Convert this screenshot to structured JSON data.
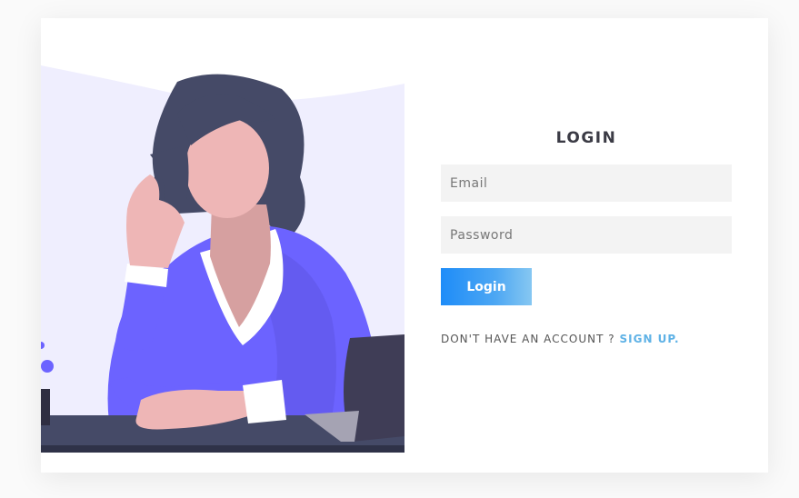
{
  "form": {
    "title": "LOGIN",
    "email_placeholder": "Email",
    "password_placeholder": "Password",
    "login_label": "Login",
    "signup_prompt": "DON'T HAVE AN ACCOUNT ?",
    "signup_link": "SIGN UP."
  },
  "colors": {
    "accent": "#1e8cf8",
    "link": "#5fb2e6",
    "field_bg": "#f3f3f3",
    "illustration_bg": "#efeefe",
    "shirt": "#6c63ff",
    "hair": "#454a67"
  },
  "illustration": {
    "icon": "woman-at-desk-illustration"
  }
}
